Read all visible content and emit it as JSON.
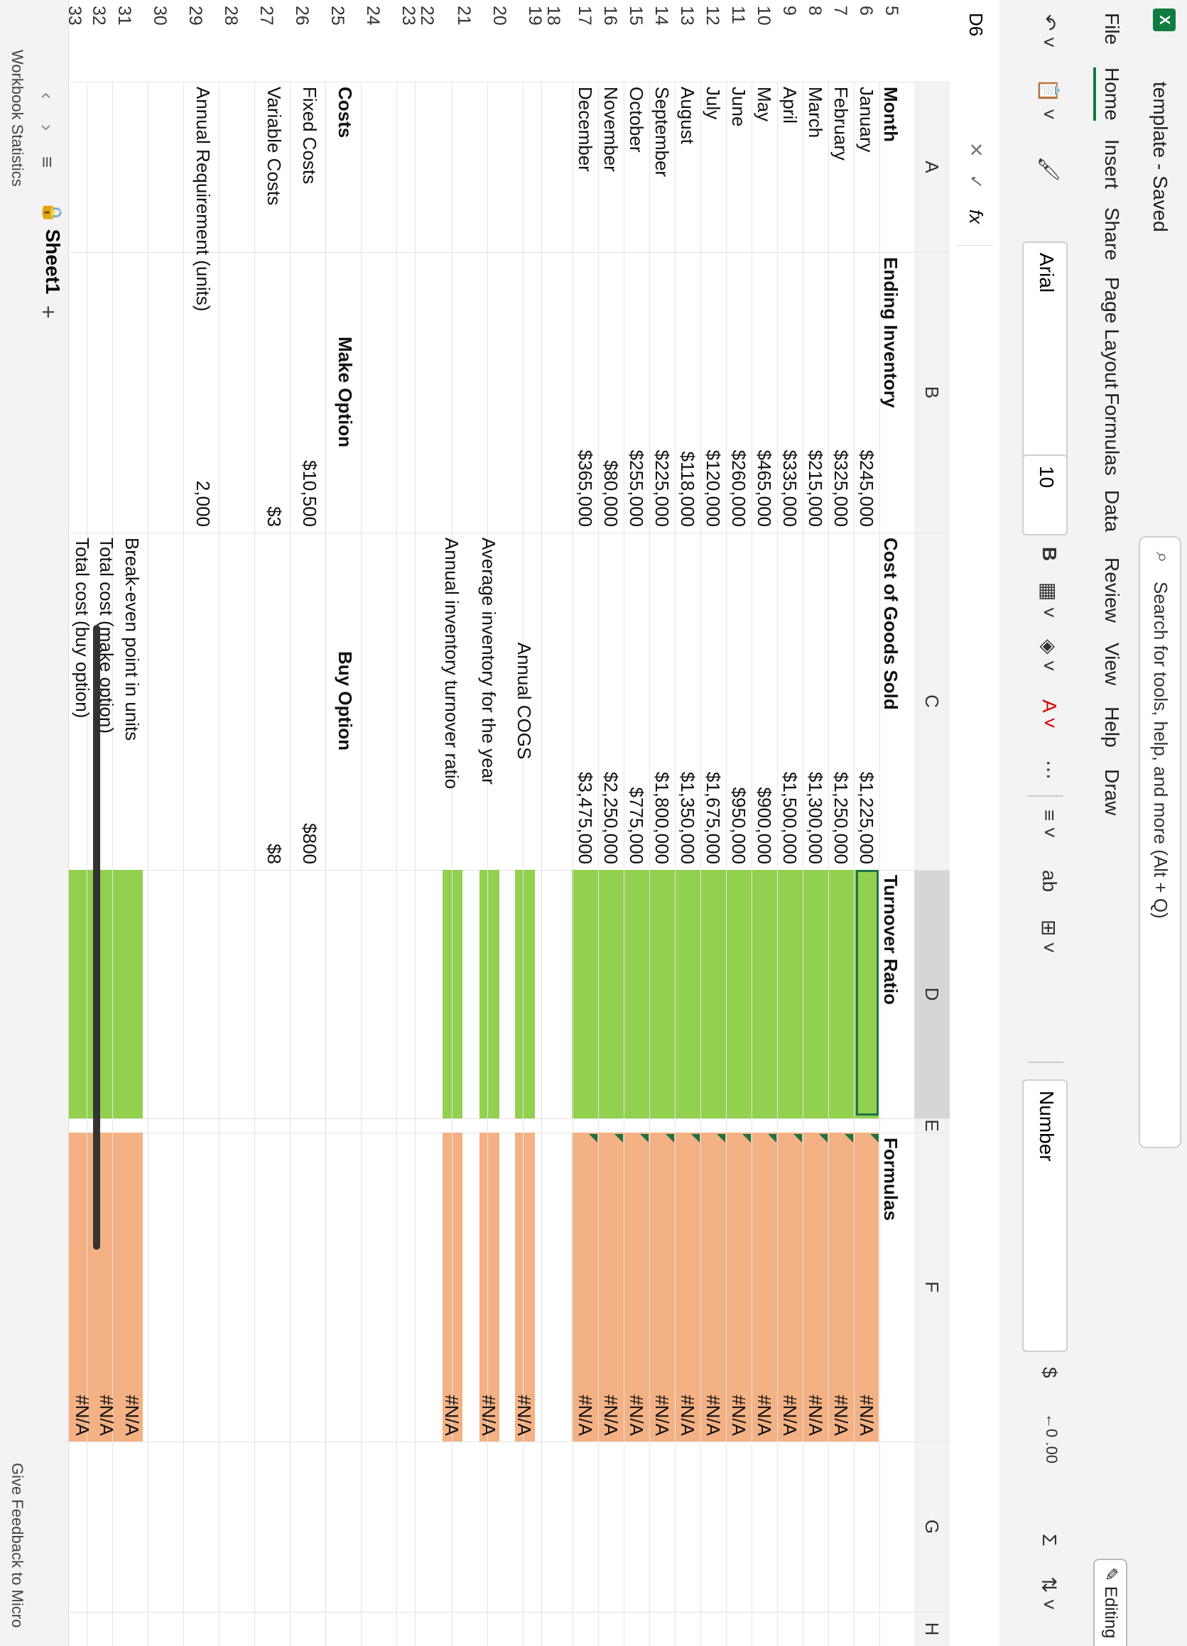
{
  "app": {
    "title": "template - Saved",
    "search_placeholder": "Search for tools, help, and more (Alt + Q)",
    "editing_label": "Editing"
  },
  "menu": [
    "File",
    "Home",
    "Insert",
    "Share",
    "Page Layout",
    "Formulas",
    "Data",
    "Review",
    "View",
    "Help",
    "Draw"
  ],
  "ribbon": {
    "font_name": "Arial",
    "font_size": "10",
    "bold": "B",
    "number_format": "Number",
    "currency_symbol": "$",
    "wrap_label": "ab",
    "sum_symbol": "Σ"
  },
  "formula_bar": {
    "cell_ref": "D6",
    "fx": "fx"
  },
  "columns": [
    "A",
    "B",
    "C",
    "D",
    "E",
    "F",
    "G",
    "H"
  ],
  "rows": [
    "5",
    "6",
    "7",
    "8",
    "9",
    "10",
    "11",
    "12",
    "13",
    "14",
    "15",
    "16",
    "17",
    "18",
    "19",
    "20",
    "21",
    "22",
    "23",
    "24",
    "25",
    "26",
    "27",
    "28",
    "29",
    "30",
    "31",
    "32",
    "33"
  ],
  "headers": {
    "month": "Month",
    "ending_inventory": "Ending Inventory",
    "cogs": "Cost of Goods Sold",
    "turnover": "Turnover Ratio",
    "formulas": "Formulas"
  },
  "months": [
    {
      "month": "January",
      "inv": "$245,000",
      "cogs": "$1,225,000",
      "f": "#N/A"
    },
    {
      "month": "February",
      "inv": "$325,000",
      "cogs": "$1,250,000",
      "f": "#N/A"
    },
    {
      "month": "March",
      "inv": "$215,000",
      "cogs": "$1,300,000",
      "f": "#N/A"
    },
    {
      "month": "April",
      "inv": "$335,000",
      "cogs": "$1,500,000",
      "f": "#N/A"
    },
    {
      "month": "May",
      "inv": "$465,000",
      "cogs": "$900,000",
      "f": "#N/A"
    },
    {
      "month": "June",
      "inv": "$260,000",
      "cogs": "$950,000",
      "f": "#N/A"
    },
    {
      "month": "July",
      "inv": "$120,000",
      "cogs": "$1,675,000",
      "f": "#N/A"
    },
    {
      "month": "August",
      "inv": "$118,000",
      "cogs": "$1,350,000",
      "f": "#N/A"
    },
    {
      "month": "September",
      "inv": "$225,000",
      "cogs": "$1,800,000",
      "f": "#N/A"
    },
    {
      "month": "October",
      "inv": "$255,000",
      "cogs": "$775,000",
      "f": "#N/A"
    },
    {
      "month": "November",
      "inv": "$80,000",
      "cogs": "$2,250,000",
      "f": "#N/A"
    },
    {
      "month": "December",
      "inv": "$365,000",
      "cogs": "$3,475,000",
      "f": "#N/A"
    }
  ],
  "summary": {
    "annual_cogs": "Annual COGS",
    "annual_cogs_f": "#N/A",
    "avg_inventory": "Average inventory for the year",
    "avg_inventory_f": "#N/A",
    "turnover_ratio": "Annual inventory turnover ratio",
    "turnover_ratio_f": "#N/A"
  },
  "costs": {
    "costs_label": "Costs",
    "make_option": "Make Option",
    "buy_option": "Buy Option",
    "fixed_costs": "Fixed Costs",
    "fixed_make": "$10,500",
    "fixed_buy": "$800",
    "variable_costs": "Variable Costs",
    "variable_make": "$3",
    "variable_buy": "$8",
    "annual_req": "Annual Requirement (units)",
    "annual_req_value": "2,000",
    "breakeven": "Break-even point in units",
    "breakeven_f": "#N/A",
    "total_make": "Total cost (make option)",
    "total_make_f": "#N/A",
    "total_buy": "Total cost (buy option)",
    "total_buy_f": "#N/A"
  },
  "sheet": {
    "tab_name": "Sheet1",
    "add": "+",
    "status": "Workbook Statistics",
    "feedback": "Give Feedback to Micro"
  },
  "colors": {
    "green": "#92d050",
    "orange": "#f4b183",
    "excel_green": "#107c41"
  }
}
